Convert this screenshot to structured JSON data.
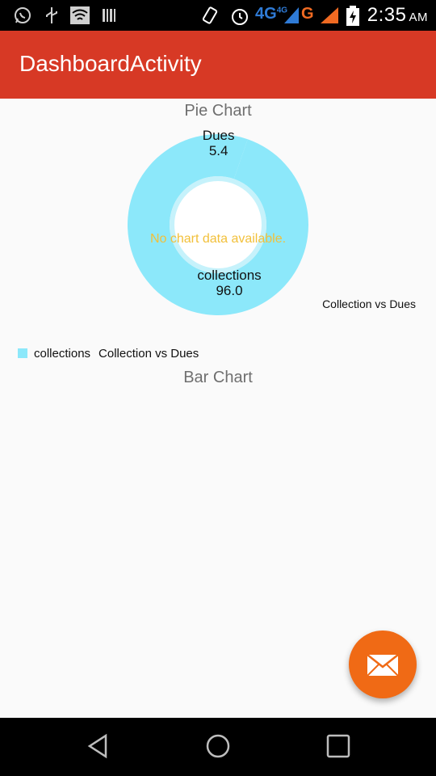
{
  "status_bar": {
    "time": "2:35",
    "ampm": "AM",
    "network_primary": "4G",
    "network_primary_sup": "4G",
    "network_secondary": "G",
    "icons": [
      "whatsapp-icon",
      "usb-icon",
      "wifi-icon",
      "barcode-icon",
      "vibrate-icon",
      "alarm-icon",
      "signal-icon",
      "battery-charging-icon"
    ]
  },
  "app_bar": {
    "title": "DashboardActivity",
    "color": "#d73925"
  },
  "pie_section": {
    "title": "Pie Chart",
    "no_data_text": "No chart data available.",
    "description": "Collection vs Dues"
  },
  "legend": {
    "entries": [
      {
        "label": "collections",
        "color": "#8ce8fa"
      }
    ],
    "dataset_label": "Collection vs Dues"
  },
  "bar_section": {
    "title": "Bar Chart"
  },
  "fab": {
    "icon": "mail-icon",
    "color": "#f06a15"
  },
  "nav_bar": {
    "icons": [
      "back-icon",
      "home-icon",
      "recents-icon"
    ]
  },
  "chart_data": {
    "type": "pie",
    "title": "Pie Chart",
    "categories": [
      "Dues",
      "collections"
    ],
    "values": [
      5.4,
      96.0
    ],
    "value_labels": [
      "5.4",
      "96.0"
    ],
    "colors": [
      "#8ce8fa",
      "#8ce8fa"
    ],
    "hole": true,
    "description": "Collection vs Dues"
  }
}
